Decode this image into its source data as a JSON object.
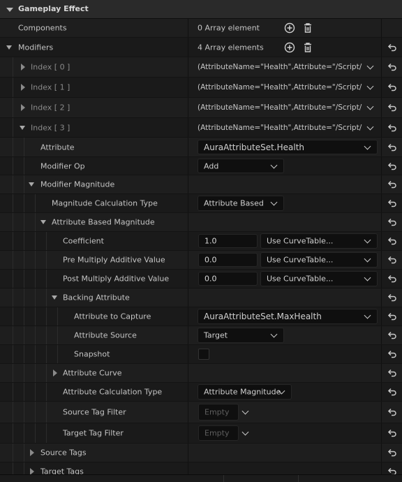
{
  "section": {
    "title": "Gameplay Effect"
  },
  "components": {
    "label": "Components",
    "value": "0 Array element"
  },
  "modifiers": {
    "label": "Modifiers",
    "value": "4 Array elements"
  },
  "indices": [
    {
      "label": "Index [ 0 ]",
      "value": "(AttributeName=\"Health\",Attribute=\"/Script/"
    },
    {
      "label": "Index [ 1 ]",
      "value": "(AttributeName=\"Health\",Attribute=\"/Script/"
    },
    {
      "label": "Index [ 2 ]",
      "value": "(AttributeName=\"Health\",Attribute=\"/Script/"
    },
    {
      "label": "Index [ 3 ]",
      "value": "(AttributeName=\"Health\",Attribute=\"/Script/"
    }
  ],
  "attribute": {
    "label": "Attribute",
    "value": "AuraAttributeSet.Health"
  },
  "modifier_op": {
    "label": "Modifier Op",
    "value": "Add"
  },
  "modifier_magnitude": {
    "label": "Modifier Magnitude"
  },
  "magnitude_calc_type": {
    "label": "Magnitude Calculation Type",
    "value": "Attribute Based"
  },
  "attribute_based_magnitude": {
    "label": "Attribute Based Magnitude"
  },
  "coefficient": {
    "label": "Coefficient",
    "value": "1.0",
    "curve": "Use CurveTable..."
  },
  "pre_multiply": {
    "label": "Pre Multiply Additive Value",
    "value": "0.0",
    "curve": "Use CurveTable..."
  },
  "post_multiply": {
    "label": "Post Multiply Additive Value",
    "value": "0.0",
    "curve": "Use CurveTable..."
  },
  "backing_attribute": {
    "label": "Backing Attribute"
  },
  "attribute_to_capture": {
    "label": "Attribute to Capture",
    "value": "AuraAttributeSet.MaxHealth"
  },
  "attribute_source": {
    "label": "Attribute Source",
    "value": "Target"
  },
  "snapshot": {
    "label": "Snapshot",
    "checked": false
  },
  "attribute_curve": {
    "label": "Attribute Curve"
  },
  "attribute_calc_type": {
    "label": "Attribute Calculation Type",
    "value": "Attribute Magnitude"
  },
  "source_tag_filter": {
    "label": "Source Tag Filter",
    "value": "Empty"
  },
  "target_tag_filter": {
    "label": "Target Tag Filter",
    "value": "Empty"
  },
  "source_tags": {
    "label": "Source Tags"
  },
  "target_tags": {
    "label": "Target Tags"
  },
  "icons": {
    "add": "plus-circle",
    "delete": "trash",
    "reset": "reset-arrow"
  }
}
